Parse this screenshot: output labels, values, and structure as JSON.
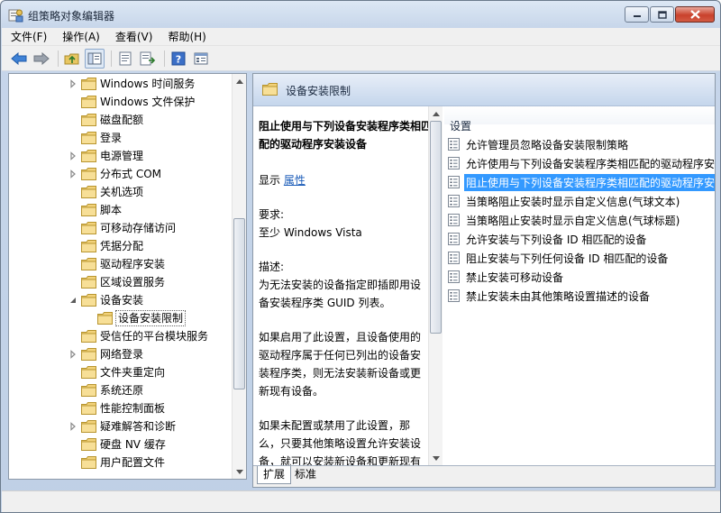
{
  "window": {
    "title": "组策略对象编辑器",
    "accent": "#3399ff"
  },
  "menu": {
    "items": [
      "文件(F)",
      "操作(A)",
      "查看(V)",
      "帮助(H)"
    ]
  },
  "toolbar": {
    "buttons": [
      "back-icon",
      "forward-icon",
      "up-folder-icon",
      "show-tree-icon",
      "properties-icon",
      "export-list-icon",
      "help-icon",
      "view-icon"
    ]
  },
  "tree": {
    "items": [
      {
        "label": "Windows 时间服务",
        "expandable": true,
        "indent": 1
      },
      {
        "label": "Windows 文件保护",
        "expandable": false,
        "indent": 1
      },
      {
        "label": "磁盘配额",
        "expandable": false,
        "indent": 1
      },
      {
        "label": "登录",
        "expandable": false,
        "indent": 1
      },
      {
        "label": "电源管理",
        "expandable": true,
        "indent": 1
      },
      {
        "label": "分布式 COM",
        "expandable": true,
        "indent": 1
      },
      {
        "label": "关机选项",
        "expandable": false,
        "indent": 1
      },
      {
        "label": "脚本",
        "expandable": false,
        "indent": 1
      },
      {
        "label": "可移动存储访问",
        "expandable": false,
        "indent": 1
      },
      {
        "label": "凭据分配",
        "expandable": false,
        "indent": 1
      },
      {
        "label": "驱动程序安装",
        "expandable": false,
        "indent": 1
      },
      {
        "label": "区域设置服务",
        "expandable": false,
        "indent": 1
      },
      {
        "label": "设备安装",
        "expandable": true,
        "expanded": true,
        "indent": 1
      },
      {
        "label": "设备安装限制",
        "expandable": false,
        "indent": 2,
        "selected": true
      },
      {
        "label": "受信任的平台模块服务",
        "expandable": false,
        "indent": 1
      },
      {
        "label": "网络登录",
        "expandable": true,
        "indent": 1
      },
      {
        "label": "文件夹重定向",
        "expandable": false,
        "indent": 1
      },
      {
        "label": "系统还原",
        "expandable": false,
        "indent": 1
      },
      {
        "label": "性能控制面板",
        "expandable": false,
        "indent": 1
      },
      {
        "label": "疑难解答和诊断",
        "expandable": true,
        "indent": 1
      },
      {
        "label": "硬盘 NV 缓存",
        "expandable": false,
        "indent": 1
      },
      {
        "label": "用户配置文件",
        "expandable": false,
        "indent": 1
      }
    ]
  },
  "right": {
    "header_title": "设备安装限制",
    "desc": {
      "title": "阻止使用与下列设备安装程序类相匹配的驱动程序安装设备",
      "show_label": "显示",
      "show_link": "属性",
      "req_label": "要求:",
      "req_value": "至少 Windows Vista",
      "desc_label": "描述:",
      "desc_p1": "为无法安装的设备指定即插即用设备安装程序类 GUID 列表。",
      "desc_p2": "如果启用了此设置，且设备使用的驱动程序属于任何已列出的设备安装程序类，则无法安装新设备或更新现有设备。",
      "desc_p3": "如果未配置或禁用了此设置，那么，只要其他策略设置允许安装设备，就可以安装新设备和更新现有设备。"
    },
    "list_header": "设置",
    "settings": [
      {
        "label": "允许管理员忽略设备安装限制策略"
      },
      {
        "label": "允许使用与下列设备安装程序类相匹配的驱动程序安装设备"
      },
      {
        "label": "阻止使用与下列设备安装程序类相匹配的驱动程序安装设备",
        "selected": true
      },
      {
        "label": "当策略阻止安装时显示自定义信息(气球文本)"
      },
      {
        "label": "当策略阻止安装时显示自定义信息(气球标题)"
      },
      {
        "label": "允许安装与下列设备 ID 相匹配的设备"
      },
      {
        "label": "阻止安装与下列任何设备 ID 相匹配的设备"
      },
      {
        "label": "禁止安装可移动设备"
      },
      {
        "label": "禁止安装未由其他策略设置描述的设备"
      }
    ],
    "tabs": [
      "扩展",
      "标准"
    ]
  }
}
